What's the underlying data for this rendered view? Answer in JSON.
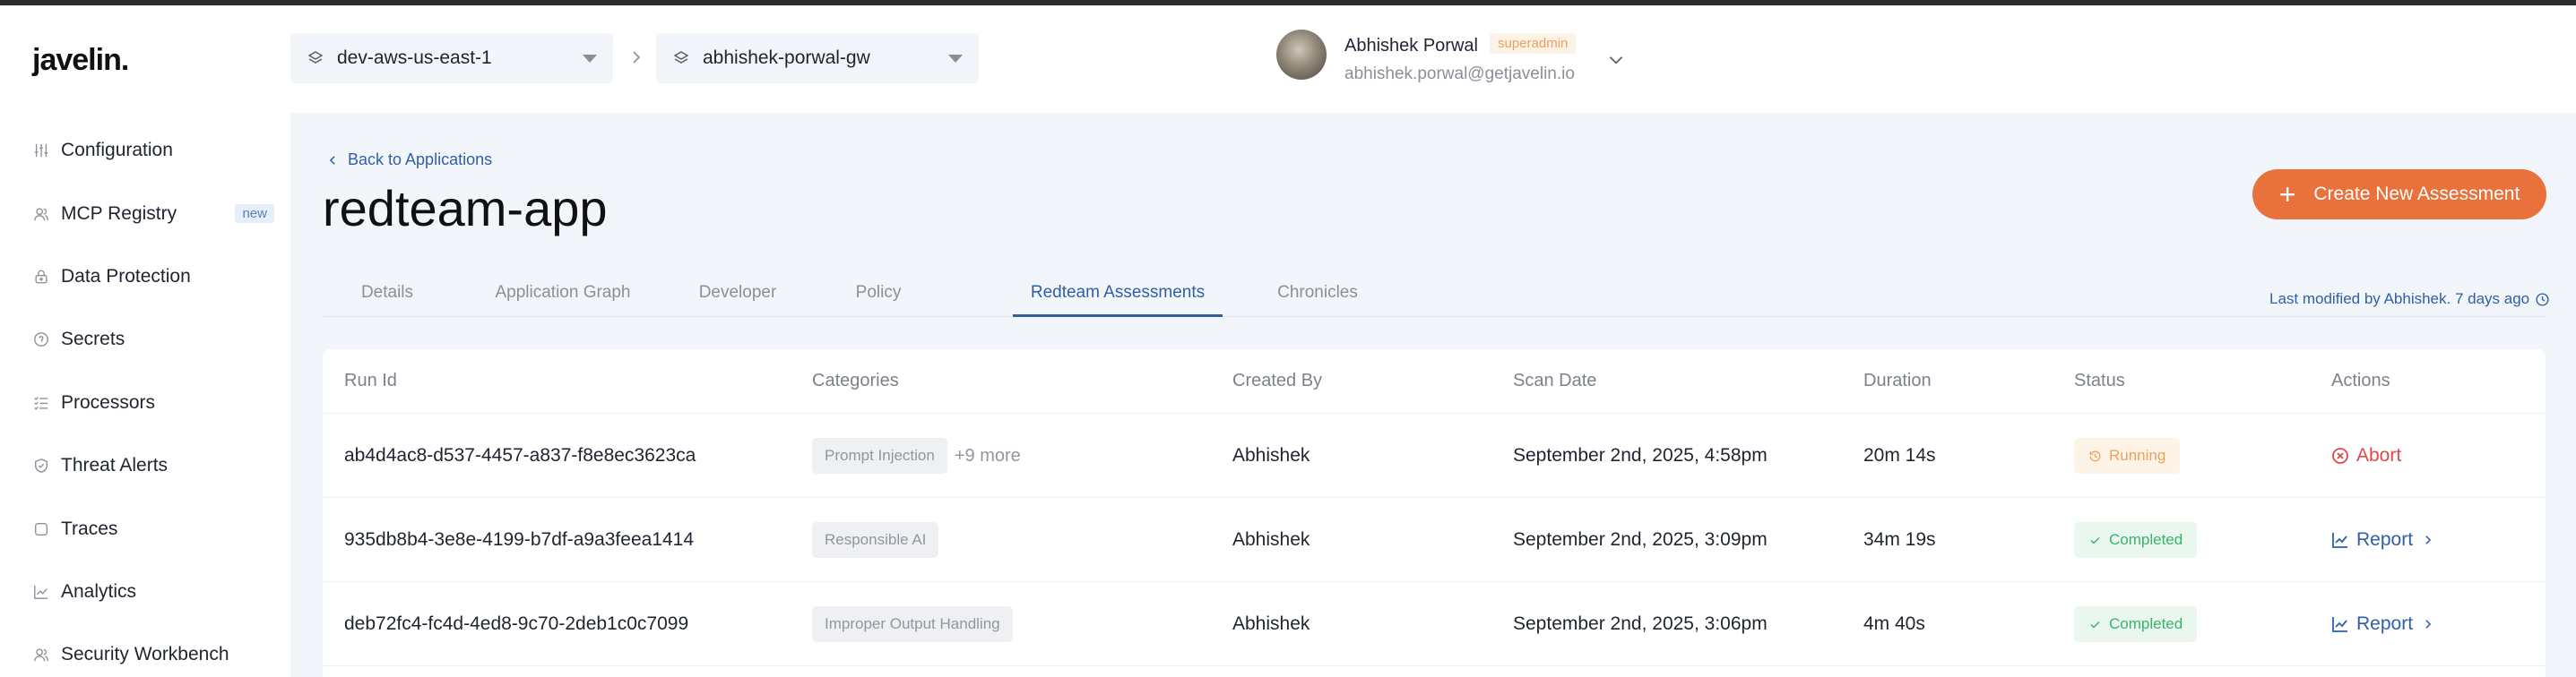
{
  "app": {
    "logo": "javelin."
  },
  "sidebar": {
    "items": [
      {
        "label": "Configuration",
        "icon": "sliders-icon"
      },
      {
        "label": "MCP Registry",
        "icon": "users-icon",
        "badge": "new"
      },
      {
        "label": "Data Protection",
        "icon": "lock-icon"
      },
      {
        "label": "Secrets",
        "icon": "shield-icon"
      },
      {
        "label": "Processors",
        "icon": "list-check-icon"
      },
      {
        "label": "Threat Alerts",
        "icon": "shield-check-icon"
      },
      {
        "label": "Traces",
        "icon": "square-icon"
      },
      {
        "label": "Analytics",
        "icon": "line-chart-icon"
      },
      {
        "label": "Security Workbench",
        "icon": "users-icon"
      }
    ]
  },
  "header": {
    "environment": "dev-aws-us-east-1",
    "gateway": "abhishek-porwal-gw",
    "user": {
      "name": "Abhishek Porwal",
      "role": "superadmin",
      "email": "abhishek.porwal@getjavelin.io"
    }
  },
  "page": {
    "back_label": "Back to Applications",
    "title": "redteam-app",
    "create_label": "Create New Assessment",
    "last_modified": "Last modified by Abhishek. 7 days ago",
    "tabs": [
      {
        "label": "Details"
      },
      {
        "label": "Application Graph"
      },
      {
        "label": "Developer"
      },
      {
        "label": "Policy"
      },
      {
        "label": "Redteam Assessments"
      },
      {
        "label": "Chronicles"
      }
    ],
    "active_tab": "Redteam Assessments"
  },
  "table": {
    "columns": [
      "Run Id",
      "Categories",
      "Created By",
      "Scan Date",
      "Duration",
      "Status",
      "Actions"
    ],
    "rows": [
      {
        "run_id": "ab4d4ac8-d537-4457-a837-f8e8ec3623ca",
        "category": "Prompt Injection",
        "more": "+9 more",
        "created_by": "Abhishek",
        "scan_date": "September 2nd, 2025, 4:58pm",
        "duration": "20m 14s",
        "status": "Running",
        "action": "Abort"
      },
      {
        "run_id": "935db8b4-3e8e-4199-b7df-a9a3feea1414",
        "category": "Responsible AI",
        "created_by": "Abhishek",
        "scan_date": "September 2nd, 2025, 3:09pm",
        "duration": "34m 19s",
        "status": "Completed",
        "action": "Report"
      },
      {
        "run_id": "deb72fc4-fc4d-4ed8-9c70-2deb1c0c7099",
        "category": "Improper Output Handling",
        "created_by": "Abhishek",
        "scan_date": "September 2nd, 2025, 3:06pm",
        "duration": "4m 40s",
        "status": "Completed",
        "action": "Report"
      }
    ]
  },
  "colors": {
    "accent": "#e8713c",
    "link": "#2e5fa8",
    "running": "#eba25d",
    "completed": "#3cb36b",
    "danger": "#e04848"
  }
}
